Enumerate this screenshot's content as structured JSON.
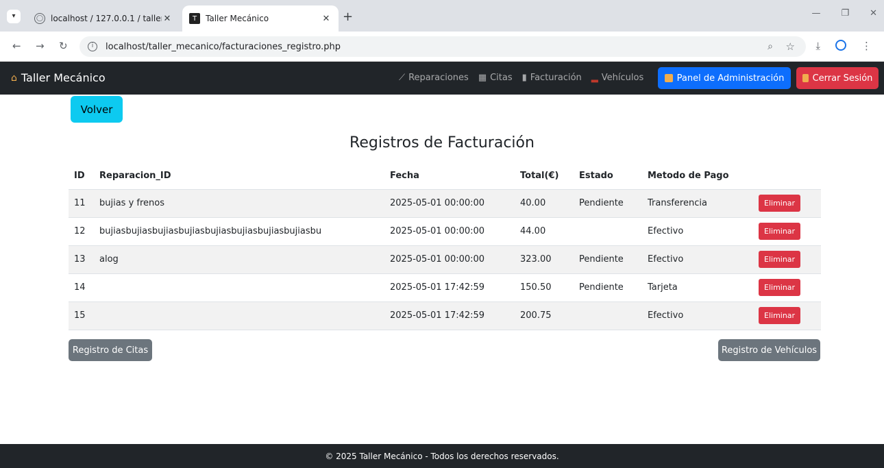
{
  "browser": {
    "tabs": [
      {
        "title": "localhost / 127.0.0.1 / taller_mec",
        "active": false
      },
      {
        "title": "Taller Mecánico",
        "active": true
      }
    ],
    "url": "localhost/taller_mecanico/facturaciones_registro.php"
  },
  "navbar": {
    "brand": "Taller Mecánico",
    "links": [
      {
        "icon": "wrench-icon",
        "label": "Reparaciones"
      },
      {
        "icon": "calendar-icon",
        "label": "Citas"
      },
      {
        "icon": "receipt-icon",
        "label": "Facturación"
      },
      {
        "icon": "car-icon",
        "label": "Vehículos"
      }
    ],
    "admin_label": "Panel de Administración",
    "logout_label": "Cerrar Sesión"
  },
  "main": {
    "back_label": "Volver",
    "title": "Registros de Facturación",
    "table": {
      "headers": [
        "ID",
        "Reparacion_ID",
        "Fecha",
        "Total(€)",
        "Estado",
        "Metodo de Pago",
        ""
      ],
      "rows": [
        {
          "id": "11",
          "reparacion": "bujias y frenos",
          "fecha": "2025-05-01 00:00:00",
          "total": "40.00",
          "estado": "Pendiente",
          "metodo": "Transferencia",
          "action": "Eliminar"
        },
        {
          "id": "12",
          "reparacion": "bujiasbujiasbujiasbujiasbujiasbujiasbujiasbujiasbu",
          "fecha": "2025-05-01 00:00:00",
          "total": "44.00",
          "estado": "",
          "metodo": "Efectivo",
          "action": "Eliminar"
        },
        {
          "id": "13",
          "reparacion": "alog",
          "fecha": "2025-05-01 00:00:00",
          "total": "323.00",
          "estado": "Pendiente",
          "metodo": "Efectivo",
          "action": "Eliminar"
        },
        {
          "id": "14",
          "reparacion": "",
          "fecha": "2025-05-01 17:42:59",
          "total": "150.50",
          "estado": "Pendiente",
          "metodo": "Tarjeta",
          "action": "Eliminar"
        },
        {
          "id": "15",
          "reparacion": "",
          "fecha": "2025-05-01 17:42:59",
          "total": "200.75",
          "estado": "",
          "metodo": "Efectivo",
          "action": "Eliminar"
        }
      ]
    },
    "citas_label": "Registro de Citas",
    "vehiculos_label": "Registro de Vehículos"
  },
  "footer": {
    "text": "© 2025 Taller Mecánico - Todos los derechos reservados."
  },
  "colors": {
    "navbar_bg": "#212529",
    "primary": "#0d6efd",
    "danger": "#dc3545",
    "info": "#0dcaf0",
    "secondary": "#6c757d"
  }
}
